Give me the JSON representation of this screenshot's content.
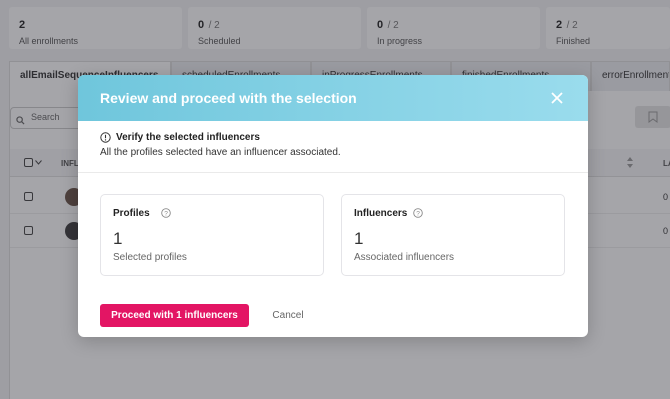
{
  "stats": [
    {
      "num": "2",
      "den": "",
      "label": "All enrollments"
    },
    {
      "num": "0",
      "den": "/ 2",
      "label": "Scheduled"
    },
    {
      "num": "0",
      "den": "/ 2",
      "label": "In progress"
    },
    {
      "num": "2",
      "den": "/ 2",
      "label": "Finished"
    }
  ],
  "tabs": [
    {
      "label": "allEmailSequenceInfluencers"
    },
    {
      "label": "scheduledEnrollments"
    },
    {
      "label": "inProgressEnrollments"
    },
    {
      "label": "finishedEnrollments"
    },
    {
      "label": "errorEnrollments"
    }
  ],
  "search": {
    "placeholder": "Search"
  },
  "table": {
    "header_first": "INFL",
    "header_last": "LA",
    "rows": [
      {
        "last_cell": "0"
      },
      {
        "last_cell": "0"
      }
    ]
  },
  "modal": {
    "title": "Review and proceed with the selection",
    "notice_title": "Verify the selected influencers",
    "notice_body": "All the profiles selected have an influencer associated.",
    "cards": [
      {
        "title": "Profiles",
        "value": "1",
        "subtitle": "Selected profiles"
      },
      {
        "title": "Influencers",
        "value": "1",
        "subtitle": "Associated influencers"
      }
    ],
    "proceed_label": "Proceed with 1 influencers",
    "cancel_label": "Cancel"
  },
  "colors": {
    "accent": "#e31564",
    "header_gradient_start": "#6fc6dc",
    "header_gradient_end": "#9adced"
  }
}
